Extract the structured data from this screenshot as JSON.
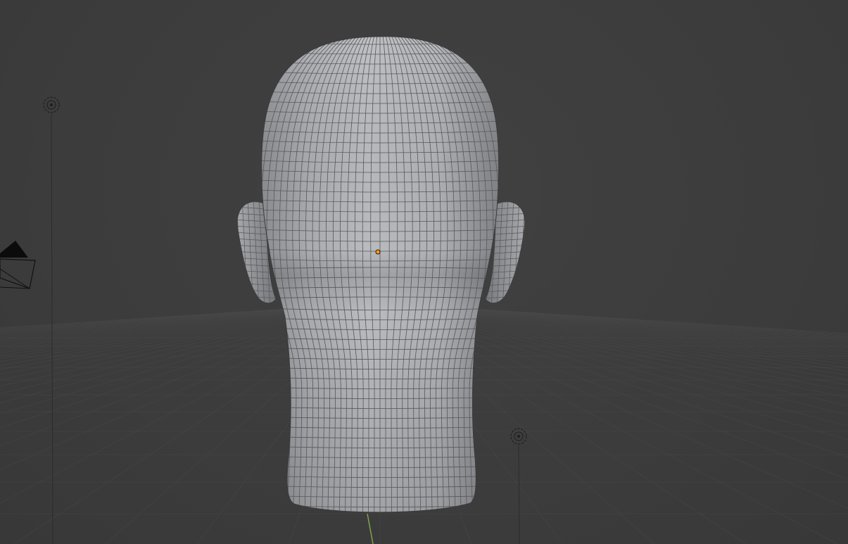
{
  "viewport": {
    "name": "3D Viewport",
    "background_color": "#3d3d3d",
    "grid_color": "#4a4a4a",
    "y_axis_color": "#6e9a3c"
  },
  "objects": [
    {
      "name": "head-mesh",
      "type": "mesh",
      "selected": true,
      "origin_color": "#ff9a1f",
      "surface_color": "#b4b6b9"
    },
    {
      "name": "light-1",
      "type": "light-icon"
    },
    {
      "name": "light-2",
      "type": "light-icon"
    },
    {
      "name": "camera",
      "type": "camera-icon"
    }
  ]
}
